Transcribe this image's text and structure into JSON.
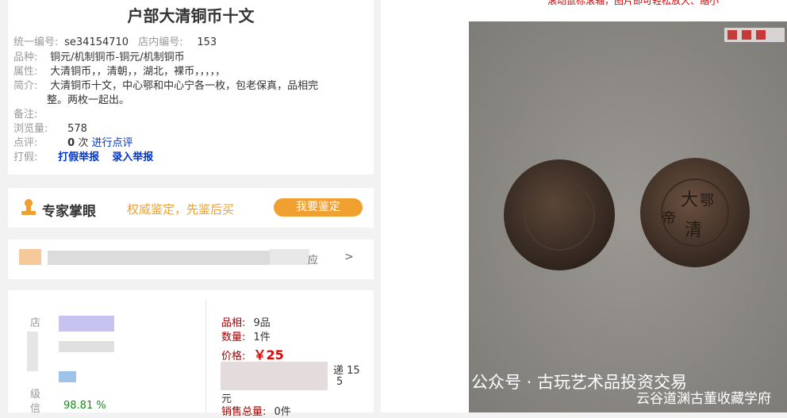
{
  "info": {
    "title": "户部大清铜币十文",
    "serial_label": "统一编号:",
    "serial_value": "se34154710",
    "store_no_label": "店内编号:",
    "store_no_value": "153",
    "category_label": "品种:",
    "category_value": "铜元/机制铜币-铜元/机制铜币",
    "attr_label": "属性:",
    "attr_value": "大清铜币，，清朝，，湖北，裸币，，，，，",
    "desc_label": "简介:",
    "desc_line1": "大清铜币十文，中心鄂和中心宁各一枚，包老保真，品相完",
    "desc_line2": "整。两枚一起出。",
    "note_label": "备注:",
    "views_label": "浏览量:",
    "views_value": "578",
    "review_label": "点评:",
    "review_count": "0",
    "review_unit": "次",
    "review_link": "进行点评",
    "report_label": "打假:",
    "report_link1": "打假举报",
    "report_link2": "录入举报"
  },
  "expert": {
    "title": "专家掌眼",
    "slogan": "权威鉴定，先鉴后买",
    "button": "我要鉴定"
  },
  "promo": {
    "visible_text": "应",
    "arrow": ">"
  },
  "seller": {
    "left_labels": [
      "店",
      "级",
      "信"
    ],
    "rate_value": "98.81 %",
    "grade_label": "品相:",
    "grade_value": "9品",
    "qty_label": "数量:",
    "qty_value": "1件",
    "price_label": "价格:",
    "price_value": "￥25",
    "shipping_fragment": "递 15",
    "shipping_fragment2": "5",
    "unit_fragment": "元",
    "sales_label": "销售总量:",
    "sales_value": "0件"
  },
  "image": {
    "hint": "滚动鼠标滚轴，图片即可轻松放大、缩小",
    "watermark_wechat": "公众号 · 古玩艺术品投资交易",
    "watermark_school": "云谷道渊古董收藏学府"
  },
  "colors": {
    "accent_orange": "#f0a030",
    "price_red": "#e60000",
    "link_blue": "#0033cc"
  }
}
